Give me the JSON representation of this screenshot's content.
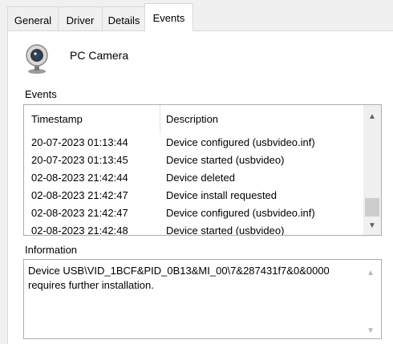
{
  "tabs": [
    {
      "label": "General",
      "active": false
    },
    {
      "label": "Driver",
      "active": false
    },
    {
      "label": "Details",
      "active": false
    },
    {
      "label": "Events",
      "active": true
    }
  ],
  "device": {
    "name": "PC Camera",
    "icon": "webcam-icon"
  },
  "events": {
    "section_label": "Events",
    "columns": {
      "timestamp": "Timestamp",
      "description": "Description"
    },
    "rows": [
      {
        "timestamp": "20-07-2023 01:13:44",
        "description": "Device configured (usbvideo.inf)"
      },
      {
        "timestamp": "20-07-2023 01:13:45",
        "description": "Device started (usbvideo)"
      },
      {
        "timestamp": "02-08-2023 21:42:44",
        "description": "Device deleted"
      },
      {
        "timestamp": "02-08-2023 21:42:47",
        "description": "Device install requested"
      },
      {
        "timestamp": "02-08-2023 21:42:47",
        "description": "Device configured (usbvideo.inf)"
      },
      {
        "timestamp": "02-08-2023 21:42:48",
        "description": "Device started (usbvideo)"
      }
    ]
  },
  "information": {
    "section_label": "Information",
    "text": "Device USB\\VID_1BCF&PID_0B13&MI_00\\7&287431f7&0&0000 requires further installation."
  },
  "colors": {
    "panel_bg": "#ffffff",
    "window_bg": "#f0f0f0",
    "border": "#adadad"
  }
}
